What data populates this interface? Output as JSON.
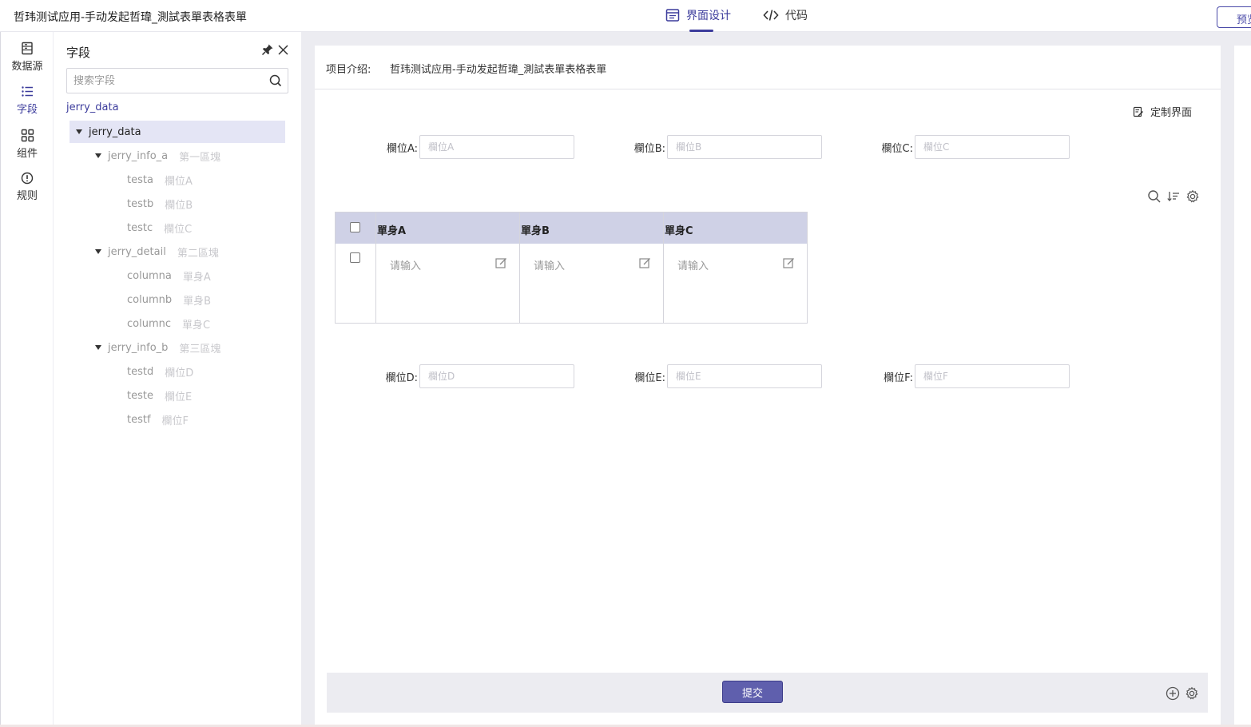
{
  "header": {
    "app_title": "哲玮测试应用-手动发起哲瑋_測試表單表格表單",
    "tabs": [
      {
        "label": "界面设计",
        "active": true,
        "icon": "layout-icon"
      },
      {
        "label": "代码",
        "active": false,
        "icon": "code-icon"
      }
    ],
    "preview_label": "预览"
  },
  "rail": {
    "items": [
      {
        "label": "数据源",
        "icon": "database-icon",
        "active": false
      },
      {
        "label": "字段",
        "icon": "list-icon",
        "active": true
      },
      {
        "label": "组件",
        "icon": "grid-icon",
        "active": false
      },
      {
        "label": "规则",
        "icon": "alert-circle-icon",
        "active": false
      }
    ]
  },
  "field_panel": {
    "title": "字段",
    "search_placeholder": "搜索字段",
    "root_link": "jerry_data",
    "tree": [
      {
        "key": "jerry_data",
        "label": ""
      },
      {
        "key": "jerry_info_a",
        "label": "第一區塊"
      },
      {
        "key": "testa",
        "label": "欄位A"
      },
      {
        "key": "testb",
        "label": "欄位B"
      },
      {
        "key": "testc",
        "label": "欄位C"
      },
      {
        "key": "jerry_detail",
        "label": "第二區塊"
      },
      {
        "key": "columna",
        "label": "單身A"
      },
      {
        "key": "columnb",
        "label": "單身B"
      },
      {
        "key": "columnc",
        "label": "單身C"
      },
      {
        "key": "jerry_info_b",
        "label": "第三區塊"
      },
      {
        "key": "testd",
        "label": "欄位D"
      },
      {
        "key": "teste",
        "label": "欄位E"
      },
      {
        "key": "testf",
        "label": "欄位F"
      }
    ]
  },
  "form": {
    "intro_label": "项目介绍:",
    "intro_value": "哲玮测试应用-手动发起哲瑋_測試表單表格表單",
    "customize_label": "定制界面",
    "fields_top": [
      {
        "label": "欄位A:",
        "placeholder": "欄位A"
      },
      {
        "label": "欄位B:",
        "placeholder": "欄位B"
      },
      {
        "label": "欄位C:",
        "placeholder": "欄位C"
      }
    ],
    "table": {
      "columns": [
        "單身A",
        "單身B",
        "單身C"
      ],
      "cell_placeholder": "请输入"
    },
    "fields_bottom": [
      {
        "label": "欄位D:",
        "placeholder": "欄位D"
      },
      {
        "label": "欄位E:",
        "placeholder": "欄位E"
      },
      {
        "label": "欄位F:",
        "placeholder": "欄位F"
      }
    ],
    "submit_label": "提交"
  },
  "colors": {
    "accent": "#3c3c9c",
    "table_header": "#cfd1e6",
    "canvas": "#ececf1",
    "submit": "#5f5fad"
  }
}
